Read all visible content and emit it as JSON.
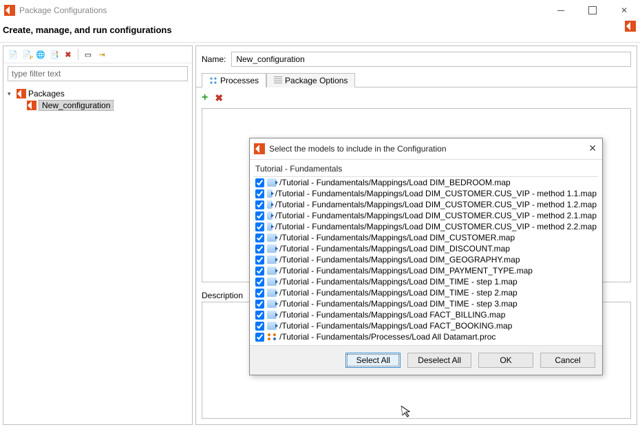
{
  "window": {
    "title": "Package Configurations",
    "subtitle": "Create, manage, and run configurations"
  },
  "left": {
    "filter_placeholder": "type filter text",
    "tree_root": "Packages",
    "tree_child": "New_configuration"
  },
  "right": {
    "name_label": "Name:",
    "name_value": "New_configuration",
    "tab_processes": "Processes",
    "tab_options": "Package Options",
    "desc_label": "Description"
  },
  "modal": {
    "title": "Select the models to include in the Configuration",
    "group": "Tutorial - Fundamentals",
    "items": [
      {
        "checked": true,
        "type": "map",
        "path": "/Tutorial - Fundamentals/Mappings/Load DIM_BEDROOM.map"
      },
      {
        "checked": true,
        "type": "map",
        "path": "/Tutorial - Fundamentals/Mappings/Load DIM_CUSTOMER.CUS_VIP - method 1.1.map"
      },
      {
        "checked": true,
        "type": "map",
        "path": "/Tutorial - Fundamentals/Mappings/Load DIM_CUSTOMER.CUS_VIP - method 1.2.map"
      },
      {
        "checked": true,
        "type": "map",
        "path": "/Tutorial - Fundamentals/Mappings/Load DIM_CUSTOMER.CUS_VIP - method 2.1.map"
      },
      {
        "checked": true,
        "type": "map",
        "path": "/Tutorial - Fundamentals/Mappings/Load DIM_CUSTOMER.CUS_VIP - method 2.2.map"
      },
      {
        "checked": true,
        "type": "map",
        "path": "/Tutorial - Fundamentals/Mappings/Load DIM_CUSTOMER.map"
      },
      {
        "checked": true,
        "type": "map",
        "path": "/Tutorial - Fundamentals/Mappings/Load DIM_DISCOUNT.map"
      },
      {
        "checked": true,
        "type": "map",
        "path": "/Tutorial - Fundamentals/Mappings/Load DIM_GEOGRAPHY.map"
      },
      {
        "checked": true,
        "type": "map",
        "path": "/Tutorial - Fundamentals/Mappings/Load DIM_PAYMENT_TYPE.map"
      },
      {
        "checked": true,
        "type": "map",
        "path": "/Tutorial - Fundamentals/Mappings/Load DIM_TIME - step 1.map"
      },
      {
        "checked": true,
        "type": "map",
        "path": "/Tutorial - Fundamentals/Mappings/Load DIM_TIME - step 2.map"
      },
      {
        "checked": true,
        "type": "map",
        "path": "/Tutorial - Fundamentals/Mappings/Load DIM_TIME - step 3.map"
      },
      {
        "checked": true,
        "type": "map",
        "path": "/Tutorial - Fundamentals/Mappings/Load FACT_BILLING.map"
      },
      {
        "checked": true,
        "type": "map",
        "path": "/Tutorial - Fundamentals/Mappings/Load FACT_BOOKING.map"
      },
      {
        "checked": true,
        "type": "proc",
        "path": "/Tutorial - Fundamentals/Processes/Load All Datamart.proc"
      }
    ],
    "buttons": {
      "select_all": "Select All",
      "deselect_all": "Deselect All",
      "ok": "OK",
      "cancel": "Cancel"
    }
  }
}
